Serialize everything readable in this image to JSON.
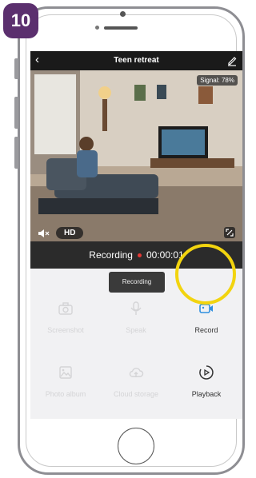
{
  "step_badge": "10",
  "header": {
    "title": "Teen retreat",
    "back_icon": "chevron-left-icon",
    "edit_icon": "pencil-icon"
  },
  "video": {
    "signal": "Signal: 78%",
    "quality": "HD",
    "mute_icon": "speaker-mute-icon",
    "fullscreen_icon": "fullscreen-icon"
  },
  "recording_bar": {
    "label": "Recording",
    "timer": "00:00:01",
    "dot_color": "#e53935"
  },
  "toast": "Recording",
  "actions": [
    {
      "label": "Screenshot",
      "icon": "camera-icon",
      "enabled": false
    },
    {
      "label": "Speak",
      "icon": "microphone-icon",
      "enabled": false
    },
    {
      "label": "Record",
      "icon": "video-camera-icon",
      "enabled": true,
      "color": "#2f8fe0"
    },
    {
      "label": "Photo album",
      "icon": "image-icon",
      "enabled": false
    },
    {
      "label": "Cloud storage",
      "icon": "cloud-upload-icon",
      "enabled": false
    },
    {
      "label": "Playback",
      "icon": "playback-icon",
      "enabled": true
    }
  ],
  "highlight_color": "#f2d40f",
  "badge_color": "#5b2f6e"
}
